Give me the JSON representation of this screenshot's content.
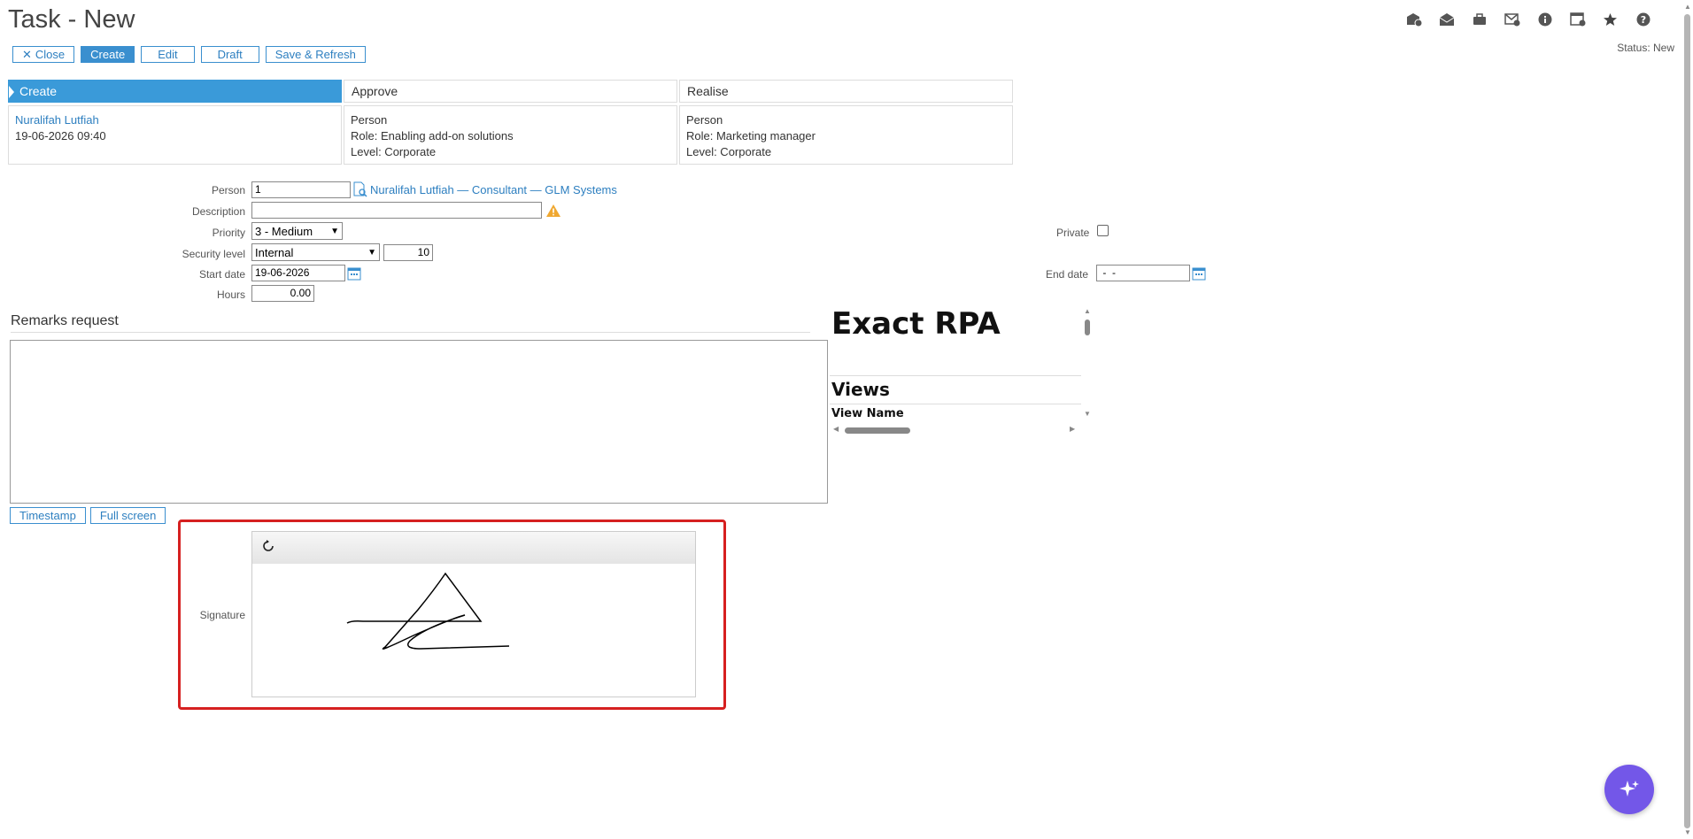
{
  "page": {
    "title": "Task - New",
    "status": "Status: New"
  },
  "toolbar": {
    "close": "Close",
    "create": "Create",
    "edit": "Edit",
    "draft": "Draft",
    "save_refresh": "Save & Refresh"
  },
  "top_icons": [
    "mail-info-icon",
    "mail-open-icon",
    "briefcase-icon",
    "mail-add-icon",
    "info-icon",
    "calendar-settings-icon",
    "star-icon",
    "help-icon"
  ],
  "workflow": {
    "steps": [
      {
        "label": "Create",
        "line1": "Nuralifah Lutfiah",
        "line2": "19-06-2026 09:40",
        "line3": ""
      },
      {
        "label": "Approve",
        "line1": "Person",
        "line2": "Role: Enabling add-on solutions",
        "line3": "Level: Corporate"
      },
      {
        "label": "Realise",
        "line1": "Person",
        "line2": "Role: Marketing manager",
        "line3": "Level: Corporate"
      }
    ]
  },
  "form": {
    "person_label": "Person",
    "person_value": "1",
    "person_link": "Nuralifah Lutfiah — Consultant — GLM Systems",
    "description_label": "Description",
    "description_value": "",
    "priority_label": "Priority",
    "priority_value": "3 - Medium",
    "private_label": "Private",
    "security_label": "Security level",
    "security_value": "Internal",
    "security_number": "10",
    "start_label": "Start date",
    "start_value": "19-06-2026",
    "end_label": "End date",
    "end_value": " -  -",
    "hours_label": "Hours",
    "hours_value": "0.00"
  },
  "remarks": {
    "title": "Remarks request",
    "timestamp": "Timestamp",
    "fullscreen": "Full screen"
  },
  "rpa": {
    "title": "Exact RPA",
    "views": "Views",
    "view_name": "View Name"
  },
  "signature": {
    "label": "Signature"
  },
  "colors": {
    "accent": "#3a9ad9",
    "highlight": "#d62020",
    "fab": "#7357e8"
  }
}
